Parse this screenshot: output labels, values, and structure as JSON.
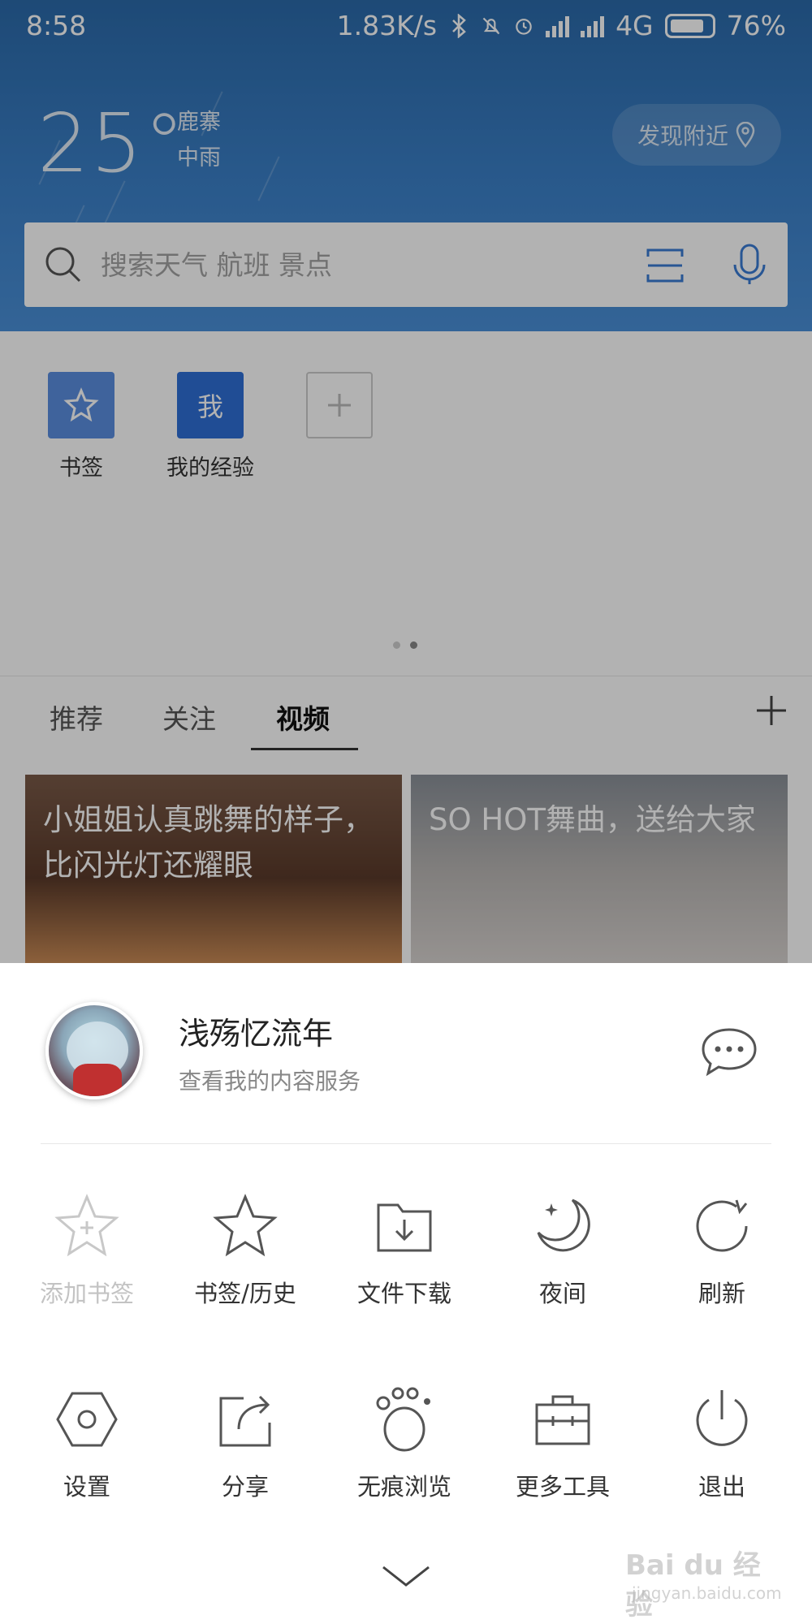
{
  "status_bar": {
    "time": "8:58",
    "net_speed": "1.83K/s",
    "network": "4G",
    "battery": "76%"
  },
  "weather": {
    "temperature": "25°",
    "city": "鹿寨",
    "condition": "中雨",
    "nearby_label": "发现附近"
  },
  "search": {
    "placeholder": "搜索天气 航班 景点"
  },
  "quick_access": {
    "items": [
      {
        "label": "书签",
        "icon": "star-icon"
      },
      {
        "label": "我的经验",
        "tile_text": "我"
      },
      {
        "label": "",
        "icon": "plus-icon"
      }
    ]
  },
  "tabs": {
    "items": [
      {
        "label": "推荐"
      },
      {
        "label": "关注"
      },
      {
        "label": "视频"
      }
    ],
    "active": "视频"
  },
  "feed": {
    "cards": [
      {
        "title": "小姐姐认真跳舞的样子，比闪光灯还耀眼"
      },
      {
        "title": "SO HOT舞曲，送给大家"
      }
    ]
  },
  "menu": {
    "user_name": "浅殇忆流年",
    "user_subtitle": "查看我的内容服务",
    "row1": [
      {
        "label": "添加书签",
        "icon": "add-bookmark-icon",
        "disabled": true
      },
      {
        "label": "书签/历史",
        "icon": "star-icon"
      },
      {
        "label": "文件下载",
        "icon": "download-folder-icon"
      },
      {
        "label": "夜间",
        "icon": "moon-icon"
      },
      {
        "label": "刷新",
        "icon": "refresh-icon"
      }
    ],
    "row2": [
      {
        "label": "设置",
        "icon": "settings-icon"
      },
      {
        "label": "分享",
        "icon": "share-icon"
      },
      {
        "label": "无痕浏览",
        "icon": "paw-icon"
      },
      {
        "label": "更多工具",
        "icon": "toolbox-icon"
      },
      {
        "label": "退出",
        "icon": "power-icon"
      }
    ]
  },
  "watermark": {
    "text": "Bai du 经验",
    "sub": "jingyan.baidu.com"
  },
  "colors": {
    "header_blue": "#3b80c8",
    "bookmark_tile": "#5b8fe0",
    "experience_tile": "#2f6fd6",
    "icon_gray": "#555555",
    "disabled_gray": "#c3c3c3"
  }
}
